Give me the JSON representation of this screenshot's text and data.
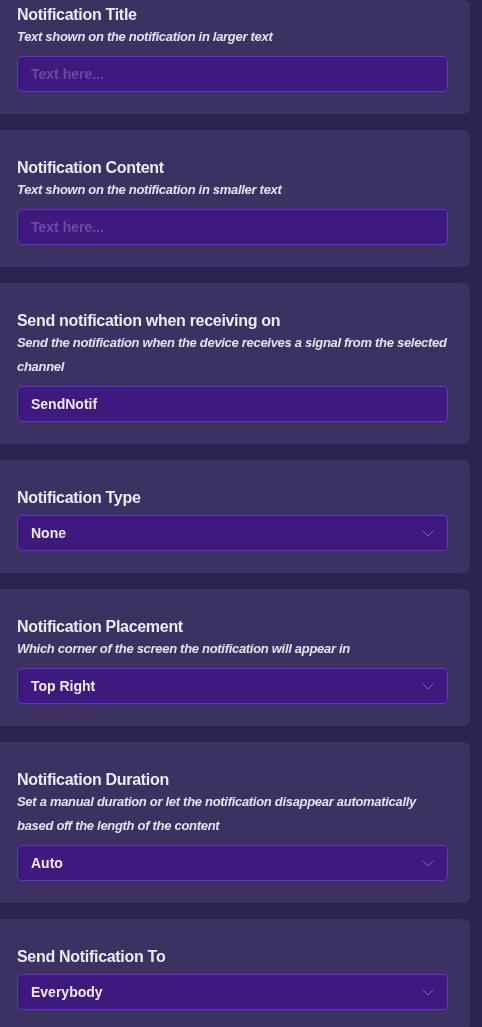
{
  "settings": [
    {
      "label": "Notification Title",
      "description": "Text shown on the notification in larger text",
      "kind": "text",
      "placeholder": "Text here..."
    },
    {
      "label": "Notification Content",
      "description": "Text shown on the notification in smaller text",
      "kind": "text",
      "placeholder": "Text here..."
    },
    {
      "label": "Send notification when receiving on",
      "description": "Send the notification when the device receives a signal from the selected channel",
      "kind": "text",
      "value": "SendNotif"
    },
    {
      "label": "Notification Type",
      "kind": "select",
      "value": "None"
    },
    {
      "label": "Notification Placement",
      "description": "Which corner of the screen the notification will appear in",
      "kind": "select",
      "value": "Top Right"
    },
    {
      "label": "Notification Duration",
      "description": "Set a manual duration or let the notification disappear automatically based off the length of the content",
      "kind": "select",
      "value": "Auto"
    },
    {
      "label": "Send Notification To",
      "kind": "select",
      "value": "Everybody"
    }
  ]
}
